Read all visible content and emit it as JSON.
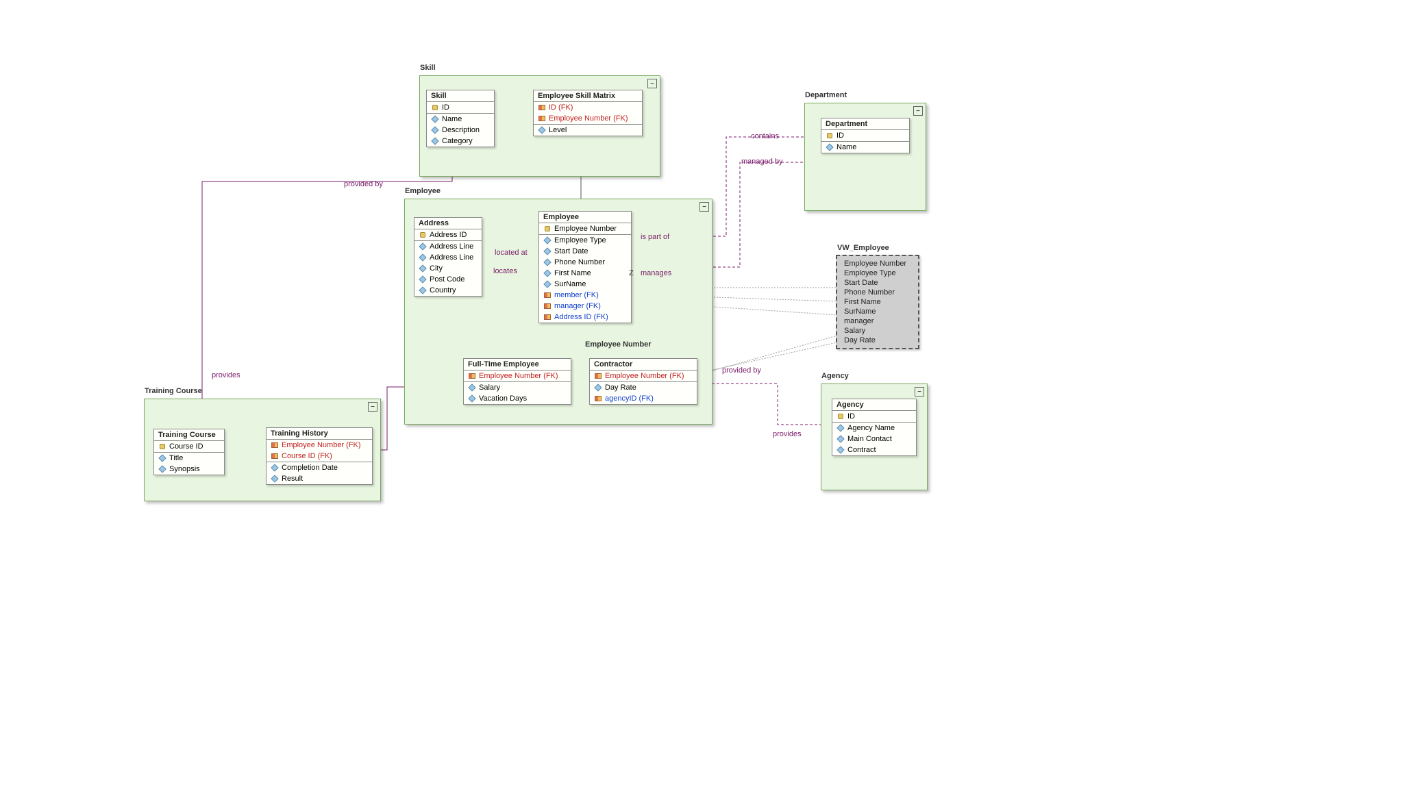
{
  "packages": {
    "skill": {
      "label": "Skill"
    },
    "employee": {
      "label": "Employee"
    },
    "department": {
      "label": "Department"
    },
    "training": {
      "label": "Training Course"
    },
    "agency": {
      "label": "Agency"
    }
  },
  "entities": {
    "skill": {
      "title": "Skill",
      "pk": [
        "ID"
      ],
      "attrs": [
        "Name",
        "Description",
        "Category"
      ]
    },
    "esm": {
      "title": "Employee Skill Matrix",
      "pk_fk": [
        "ID (FK)",
        "Employee Number (FK)"
      ],
      "attrs": [
        "Level"
      ]
    },
    "address": {
      "title": "Address",
      "pk": [
        "Address ID"
      ],
      "attrs": [
        "Address Line",
        "Address Line",
        "City",
        "Post Code",
        "Country"
      ]
    },
    "emp": {
      "title": "Employee",
      "pk": [
        "Employee Number"
      ],
      "attrs": [
        "Employee Type",
        "Start Date",
        "Phone Number",
        "First Name",
        "SurName"
      ],
      "fk_blue": [
        "member (FK)",
        "manager (FK)",
        "Address ID (FK)"
      ]
    },
    "fte": {
      "title": "Full-Time Employee",
      "pk_fk": [
        "Employee Number (FK)"
      ],
      "attrs": [
        "Salary",
        "Vacation Days"
      ]
    },
    "contractor": {
      "title": "Contractor",
      "pk_fk": [
        "Employee Number (FK)"
      ],
      "attrs": [
        "Day Rate"
      ],
      "fk_blue": [
        "agencyID (FK)"
      ]
    },
    "dept": {
      "title": "Department",
      "pk": [
        "ID"
      ],
      "attrs": [
        "Name"
      ]
    },
    "course": {
      "title": "Training Course",
      "pk": [
        "Course ID"
      ],
      "attrs": [
        "Title",
        "Synopsis"
      ]
    },
    "history": {
      "title": "Training History",
      "pk_fk": [
        "Employee Number (FK)",
        "Course ID (FK)"
      ],
      "attrs": [
        "Completion Date",
        "Result"
      ]
    },
    "agency": {
      "title": "Agency",
      "pk": [
        "ID"
      ],
      "attrs": [
        "Agency Name",
        "Main Contact",
        "Contract"
      ]
    }
  },
  "view": {
    "title": "VW_Employee",
    "attrs": [
      "Employee Number",
      "Employee Type",
      "Start Date",
      "Phone Number",
      "First Name",
      "SurName",
      "manager",
      "Salary",
      "Day Rate"
    ]
  },
  "labels": {
    "provided_by": "provided by",
    "provides": "provides",
    "located_at": "located at",
    "locates": "locates",
    "is_part_of": "is part of",
    "contains": "contains",
    "managed_by": "managed by",
    "manages": "manages",
    "z": "Z",
    "disc": "Employee Number"
  }
}
